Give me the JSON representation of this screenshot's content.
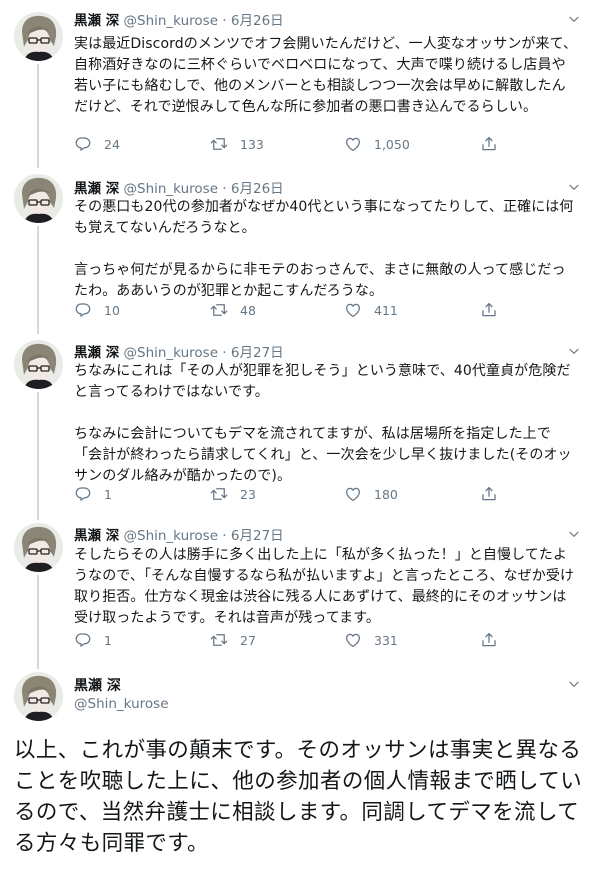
{
  "author": {
    "name": "黒瀬 深",
    "handle": "@Shin_kurose",
    "dot": "·"
  },
  "tweets": [
    {
      "date": "6月26日",
      "text": "実は最近Discordのメンツでオフ会開いたんだけど、一人変なオッサンが来て、自称酒好きなのに三杯ぐらいでベロベロになって、大声で喋り続けるし店員や若い子にも絡むしで、他のメンバーとも相談しつつ一次会は早めに解散したんだけど、それで逆恨みして色んな所に参加者の悪口書き込んでるらしい。",
      "replies": "24",
      "retweets": "133",
      "likes": "1,050"
    },
    {
      "date": "6月26日",
      "text": "その悪口も20代の参加者がなぜか40代という事になってたりして、正確には何も覚えてないんだろうなと。\n\n言っちゃ何だが見るからに非モテのおっさんで、まさに無敵の人って感じだったわ。ああいうのが犯罪とか起こすんだろうな。",
      "replies": "10",
      "retweets": "48",
      "likes": "411"
    },
    {
      "date": "6月27日",
      "text": "ちなみにこれは「その人が犯罪を犯しそう」という意味で、40代童貞が危険だと言ってるわけではないです。\n\nちなみに会計についてもデマを流されてますが、私は居場所を指定した上で「会計が終わったら請求してくれ」と、一次会を少し早く抜けました(そのオッサンのダル絡みが酷かったので)。",
      "replies": "1",
      "retweets": "23",
      "likes": "180"
    },
    {
      "date": "6月27日",
      "text": "そしたらその人は勝手に多く出した上に「私が多く払った！」と自慢してたようなので、「そんな自慢するなら私が払いますよ」と言ったところ、なぜか受け取り拒否。仕方なく現金は渋谷に残る人にあずけて、最終的にそのオッサンは受け取ったようです。それは音声が残ってます。",
      "replies": "1",
      "retweets": "27",
      "likes": "331"
    }
  ],
  "main_tweet": {
    "text": "以上、これが事の顛末です。そのオッサンは事実と異なることを吹聴した上に、他の参加者の個人情報まで晒しているので、当然弁護士に相談します。同調してデマを流してる方々も同罪です。"
  },
  "colors": {
    "text": "#14171a",
    "muted": "#657786",
    "line": "#cfd9de"
  },
  "icons": [
    "chevron-down-icon",
    "reply-icon",
    "retweet-icon",
    "like-icon",
    "share-icon"
  ]
}
